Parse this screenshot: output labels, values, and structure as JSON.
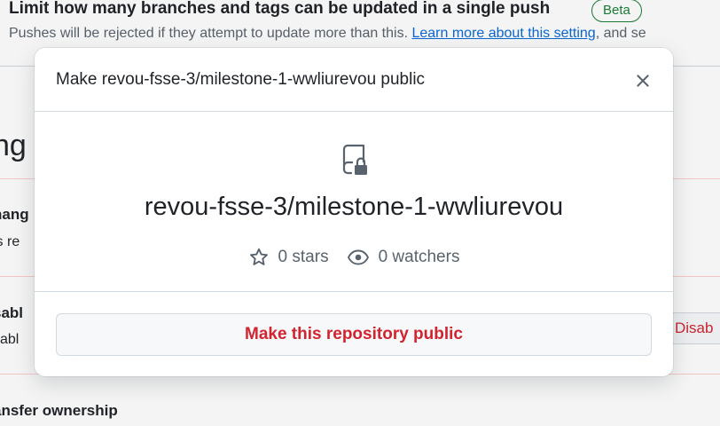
{
  "background": {
    "push_limit_title": "Limit how many branches and tags can be updated in a single push",
    "beta_badge": "Beta",
    "push_limit_desc_prefix": "Pushes will be rejected if they attempt to update more than this. ",
    "push_limit_desc_link": "Learn more about this setting",
    "push_limit_desc_suffix": ", and se",
    "section_heading_fragment": "ng",
    "row1_title_fragment": "hang",
    "row1_desc_fragment": "is re",
    "row2_title_fragment": "sabl",
    "row2_desc_fragment": "sabl",
    "row2_button_fragment": "Disab",
    "row3_title_fragment": "ansfer ownership"
  },
  "modal": {
    "title": "Make revou-fsse-3/milestone-1-wwliurevou public",
    "close_icon": "x-icon",
    "repo_icon": "repo-locked-icon",
    "repo_name": "revou-fsse-3/milestone-1-wwliurevou",
    "stars_label": "0 stars",
    "watchers_label": "0 watchers",
    "confirm_button": "Make this repository public"
  },
  "colors": {
    "danger": "#d1242f",
    "link": "#0969da",
    "beta": "#1a7f37",
    "muted": "#59636e"
  }
}
